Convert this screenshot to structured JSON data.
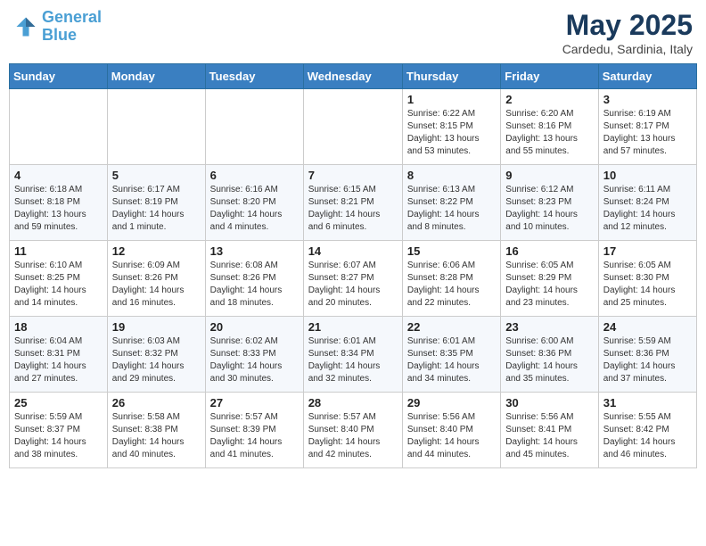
{
  "header": {
    "logo_line1": "General",
    "logo_line2": "Blue",
    "month": "May 2025",
    "location": "Cardedu, Sardinia, Italy"
  },
  "days_of_week": [
    "Sunday",
    "Monday",
    "Tuesday",
    "Wednesday",
    "Thursday",
    "Friday",
    "Saturday"
  ],
  "weeks": [
    [
      {
        "day": "",
        "info": ""
      },
      {
        "day": "",
        "info": ""
      },
      {
        "day": "",
        "info": ""
      },
      {
        "day": "",
        "info": ""
      },
      {
        "day": "1",
        "info": "Sunrise: 6:22 AM\nSunset: 8:15 PM\nDaylight: 13 hours\nand 53 minutes."
      },
      {
        "day": "2",
        "info": "Sunrise: 6:20 AM\nSunset: 8:16 PM\nDaylight: 13 hours\nand 55 minutes."
      },
      {
        "day": "3",
        "info": "Sunrise: 6:19 AM\nSunset: 8:17 PM\nDaylight: 13 hours\nand 57 minutes."
      }
    ],
    [
      {
        "day": "4",
        "info": "Sunrise: 6:18 AM\nSunset: 8:18 PM\nDaylight: 13 hours\nand 59 minutes."
      },
      {
        "day": "5",
        "info": "Sunrise: 6:17 AM\nSunset: 8:19 PM\nDaylight: 14 hours\nand 1 minute."
      },
      {
        "day": "6",
        "info": "Sunrise: 6:16 AM\nSunset: 8:20 PM\nDaylight: 14 hours\nand 4 minutes."
      },
      {
        "day": "7",
        "info": "Sunrise: 6:15 AM\nSunset: 8:21 PM\nDaylight: 14 hours\nand 6 minutes."
      },
      {
        "day": "8",
        "info": "Sunrise: 6:13 AM\nSunset: 8:22 PM\nDaylight: 14 hours\nand 8 minutes."
      },
      {
        "day": "9",
        "info": "Sunrise: 6:12 AM\nSunset: 8:23 PM\nDaylight: 14 hours\nand 10 minutes."
      },
      {
        "day": "10",
        "info": "Sunrise: 6:11 AM\nSunset: 8:24 PM\nDaylight: 14 hours\nand 12 minutes."
      }
    ],
    [
      {
        "day": "11",
        "info": "Sunrise: 6:10 AM\nSunset: 8:25 PM\nDaylight: 14 hours\nand 14 minutes."
      },
      {
        "day": "12",
        "info": "Sunrise: 6:09 AM\nSunset: 8:26 PM\nDaylight: 14 hours\nand 16 minutes."
      },
      {
        "day": "13",
        "info": "Sunrise: 6:08 AM\nSunset: 8:26 PM\nDaylight: 14 hours\nand 18 minutes."
      },
      {
        "day": "14",
        "info": "Sunrise: 6:07 AM\nSunset: 8:27 PM\nDaylight: 14 hours\nand 20 minutes."
      },
      {
        "day": "15",
        "info": "Sunrise: 6:06 AM\nSunset: 8:28 PM\nDaylight: 14 hours\nand 22 minutes."
      },
      {
        "day": "16",
        "info": "Sunrise: 6:05 AM\nSunset: 8:29 PM\nDaylight: 14 hours\nand 23 minutes."
      },
      {
        "day": "17",
        "info": "Sunrise: 6:05 AM\nSunset: 8:30 PM\nDaylight: 14 hours\nand 25 minutes."
      }
    ],
    [
      {
        "day": "18",
        "info": "Sunrise: 6:04 AM\nSunset: 8:31 PM\nDaylight: 14 hours\nand 27 minutes."
      },
      {
        "day": "19",
        "info": "Sunrise: 6:03 AM\nSunset: 8:32 PM\nDaylight: 14 hours\nand 29 minutes."
      },
      {
        "day": "20",
        "info": "Sunrise: 6:02 AM\nSunset: 8:33 PM\nDaylight: 14 hours\nand 30 minutes."
      },
      {
        "day": "21",
        "info": "Sunrise: 6:01 AM\nSunset: 8:34 PM\nDaylight: 14 hours\nand 32 minutes."
      },
      {
        "day": "22",
        "info": "Sunrise: 6:01 AM\nSunset: 8:35 PM\nDaylight: 14 hours\nand 34 minutes."
      },
      {
        "day": "23",
        "info": "Sunrise: 6:00 AM\nSunset: 8:36 PM\nDaylight: 14 hours\nand 35 minutes."
      },
      {
        "day": "24",
        "info": "Sunrise: 5:59 AM\nSunset: 8:36 PM\nDaylight: 14 hours\nand 37 minutes."
      }
    ],
    [
      {
        "day": "25",
        "info": "Sunrise: 5:59 AM\nSunset: 8:37 PM\nDaylight: 14 hours\nand 38 minutes."
      },
      {
        "day": "26",
        "info": "Sunrise: 5:58 AM\nSunset: 8:38 PM\nDaylight: 14 hours\nand 40 minutes."
      },
      {
        "day": "27",
        "info": "Sunrise: 5:57 AM\nSunset: 8:39 PM\nDaylight: 14 hours\nand 41 minutes."
      },
      {
        "day": "28",
        "info": "Sunrise: 5:57 AM\nSunset: 8:40 PM\nDaylight: 14 hours\nand 42 minutes."
      },
      {
        "day": "29",
        "info": "Sunrise: 5:56 AM\nSunset: 8:40 PM\nDaylight: 14 hours\nand 44 minutes."
      },
      {
        "day": "30",
        "info": "Sunrise: 5:56 AM\nSunset: 8:41 PM\nDaylight: 14 hours\nand 45 minutes."
      },
      {
        "day": "31",
        "info": "Sunrise: 5:55 AM\nSunset: 8:42 PM\nDaylight: 14 hours\nand 46 minutes."
      }
    ]
  ]
}
